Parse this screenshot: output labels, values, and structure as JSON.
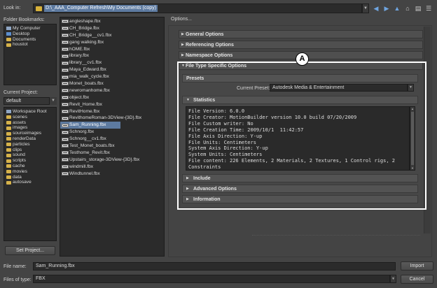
{
  "look_in": {
    "label": "Look in:",
    "path": "D:\\_AAA_Computer Refresh\\My Documents (copy)"
  },
  "toolbar": {
    "icons": [
      "back-arrow-icon",
      "forward-arrow-icon",
      "up-folder-icon",
      "home-icon",
      "bookmark-icon",
      "menu-icon"
    ]
  },
  "bookmarks": {
    "label": "Folder Bookmarks:",
    "items": [
      {
        "label": "My Computer",
        "icon": "computer-icon"
      },
      {
        "label": "Desktop",
        "icon": "desktop-icon"
      },
      {
        "label": "Documents",
        "icon": "folder-icon"
      },
      {
        "label": "houstot",
        "icon": "folder-icon"
      }
    ]
  },
  "project": {
    "label": "Current Project:",
    "value": "default",
    "tree": [
      "Workspace Root",
      "scenes",
      "assets",
      "images",
      "sourceimages",
      "renderData",
      "particles",
      "clips",
      "sound",
      "scripts",
      "cache",
      "movies",
      "data",
      "autosave"
    ],
    "set_button": "Set Project..."
  },
  "files": [
    {
      "name": "angleshape.fbx",
      "selected": false
    },
    {
      "name": "CH_Bridge.fbx",
      "selected": false
    },
    {
      "name": "CH_Bridge__cv1.fbx",
      "selected": false
    },
    {
      "name": "gang walking.fbx",
      "selected": false
    },
    {
      "name": "hOME.fbx",
      "selected": false
    },
    {
      "name": "library.fbx",
      "selected": false
    },
    {
      "name": "library__cv1.fbx",
      "selected": false
    },
    {
      "name": "Maya_Edward.fbx",
      "selected": false
    },
    {
      "name": "mia_walk_cycle.fbx",
      "selected": false
    },
    {
      "name": "Monet_boats.fbx",
      "selected": false
    },
    {
      "name": "newromanhome.fbx",
      "selected": false
    },
    {
      "name": "object.fbx",
      "selected": false
    },
    {
      "name": "Revit_Home.fbx",
      "selected": false
    },
    {
      "name": "RevitHome.fbx",
      "selected": false
    },
    {
      "name": "RevithomeRoman-3DView-{3D}.fbx",
      "selected": false
    },
    {
      "name": "Sam_Running.fbx",
      "selected": true
    },
    {
      "name": "Schnorg.fbx",
      "selected": false
    },
    {
      "name": "Schnorg__cv1.fbx",
      "selected": false
    },
    {
      "name": "Test_Monet_boats.fbx",
      "selected": false
    },
    {
      "name": "Testhome_Revit.fbx",
      "selected": false
    },
    {
      "name": "Upstairs_storage-3DView-{3D}.fbx",
      "selected": false
    },
    {
      "name": "windmill.fbx",
      "selected": false
    },
    {
      "name": "Windtunnel.fbx",
      "selected": false
    }
  ],
  "options": {
    "label": "Options...",
    "sections": [
      "General Options",
      "Referencing Options",
      "Namespace Options"
    ],
    "file_type_specific": "File Type Specific Options",
    "presets": {
      "label": "Presets",
      "current_label": "Current Preset:",
      "current_value": "Autodesk Media & Entertainment"
    },
    "statistics": {
      "label": "Statistics",
      "lines": [
        "File Version: 6.0.0",
        "File Creator: MotionBuilder version 10.0 build 07/20/2009",
        "File Custom writer: No",
        "File Creation Time: 2009/10/1  11:42:57",
        "File Axis Direction: Y-up",
        "File Units: Centimeters",
        "System Axis Direction: Y-up",
        "System Units: Centimeters",
        "File content: 226 Elements, 2 Materials, 2 Textures, 1 Control rigs, 2",
        "Constraints"
      ]
    },
    "subsections": [
      "Include",
      "Advanced Options",
      "Information"
    ],
    "callout": "A"
  },
  "bottom": {
    "file_name_label": "File name:",
    "file_name_value": "Sam_Running.fbx",
    "file_type_label": "Files of type:",
    "file_type_value": "FBX",
    "import_button": "Import",
    "cancel_button": "Cancel"
  },
  "colors": {
    "selection": "#5d7aa0",
    "highlight": "#ffffff",
    "background": "#444444"
  }
}
